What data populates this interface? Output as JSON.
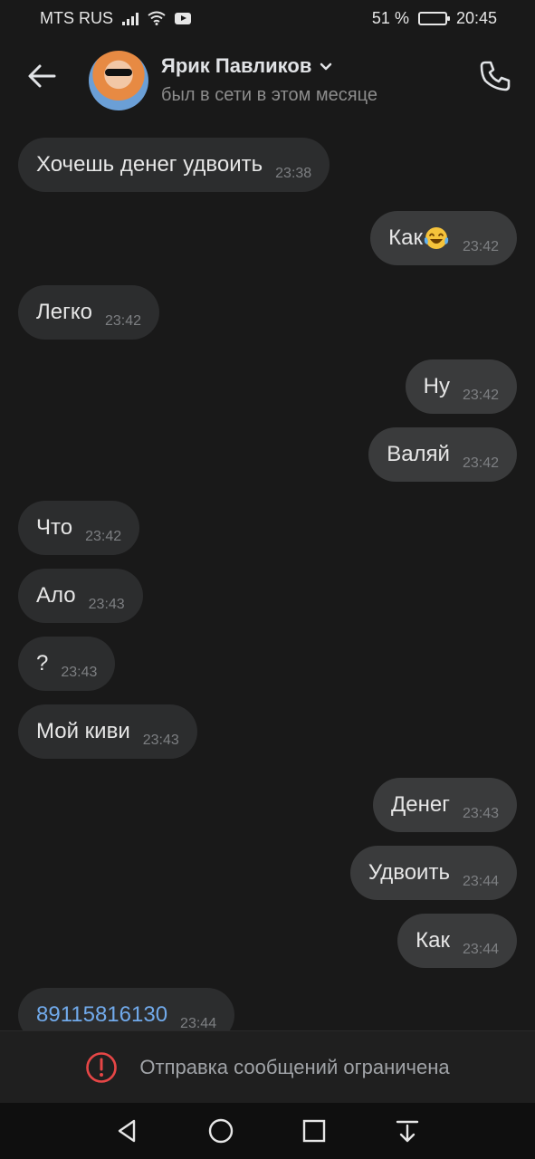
{
  "status_bar": {
    "carrier": "MTS RUS",
    "battery_percent": "51 %",
    "time": "20:45",
    "battery_level": 0.51
  },
  "header": {
    "contact_name": "Ярик Павликов",
    "contact_status": "был в сети в этом месяце",
    "icons": [
      "back-arrow-icon",
      "avatar",
      "chevron-down-icon",
      "phone-icon"
    ]
  },
  "messages": [
    {
      "direction": "in",
      "text": "Хочешь денег удвоить",
      "time": "23:38"
    },
    {
      "direction": "out",
      "text": "Как",
      "emoji": "laughing-tears-emoji",
      "time": "23:42"
    },
    {
      "direction": "in",
      "text": "Легко",
      "time": "23:42"
    },
    {
      "direction": "out",
      "text": "Ну",
      "time": "23:42"
    },
    {
      "direction": "out",
      "text": "Валяй",
      "time": "23:42"
    },
    {
      "direction": "in",
      "text": "Что",
      "time": "23:42"
    },
    {
      "direction": "in",
      "text": "Ало",
      "time": "23:43"
    },
    {
      "direction": "in",
      "text": "?",
      "time": "23:43"
    },
    {
      "direction": "in",
      "text": "Мой киви",
      "time": "23:43"
    },
    {
      "direction": "out",
      "text": "Денег",
      "time": "23:43"
    },
    {
      "direction": "out",
      "text": "Удвоить",
      "time": "23:44"
    },
    {
      "direction": "out",
      "text": "Как",
      "time": "23:44"
    },
    {
      "direction": "in",
      "text": "89115816130",
      "time": "23:44",
      "is_link": true
    }
  ],
  "restricted": {
    "text": "Отправка сообщений ограничена",
    "icon": "warning-circle-icon"
  },
  "colors": {
    "background": "#191919",
    "incoming_bubble": "#2c2d2e",
    "outgoing_bubble": "#3a3b3c",
    "link": "#71aaeb",
    "warning": "#e64646"
  },
  "navbar": {
    "icons": [
      "nav-back-icon",
      "nav-home-icon",
      "nav-recents-icon",
      "nav-notifications-icon"
    ]
  }
}
